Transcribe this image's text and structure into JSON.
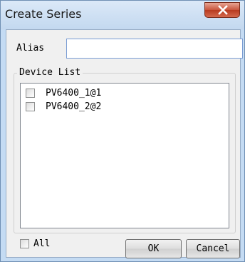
{
  "window": {
    "title": "Create Series",
    "close_icon": "close-icon"
  },
  "form": {
    "alias_label": "Alias",
    "alias_value": "",
    "alias_placeholder": ""
  },
  "device_list": {
    "legend": "Device List",
    "items": [
      {
        "label": "PV6400_1@1",
        "checked": false
      },
      {
        "label": "PV6400_2@2",
        "checked": false
      }
    ]
  },
  "footer": {
    "all_label": "All",
    "ok_label": "OK",
    "cancel_label": "Cancel"
  },
  "colors": {
    "frame": "#c4dbf3",
    "close_button": "#c8553d",
    "client_bg": "#f0f0f0"
  }
}
